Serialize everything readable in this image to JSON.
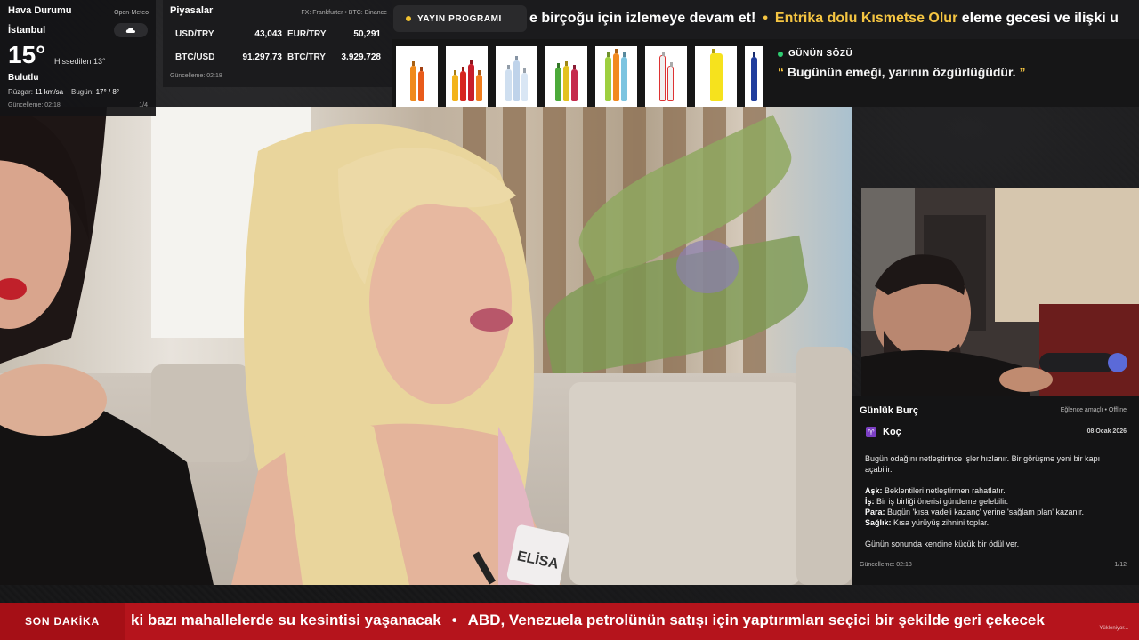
{
  "weather": {
    "title": "Hava Durumu",
    "source": "Open-Meteo",
    "city": "İstanbul",
    "temp": "15°",
    "feels_like": "Hissedilen 13°",
    "condition": "Bulutlu",
    "wind_label": "Rüzgar:",
    "wind_value": "11 km/sa",
    "today_label": "Bugün:",
    "today_value": "17° / 8°",
    "updated": "Güncelleme: 02:18",
    "page": "1/4",
    "icon": "cloud-icon"
  },
  "markets": {
    "title": "Piyasalar",
    "source": "FX: Frankfurter • BTC: Binance",
    "items": [
      {
        "label": "USD/TRY",
        "value": "43,043"
      },
      {
        "label": "EUR/TRY",
        "value": "50,291"
      },
      {
        "label": "BTC/USD",
        "value": "91.297,73"
      },
      {
        "label": "BTC/TRY",
        "value": "3.929.728"
      }
    ],
    "updated": "Güncelleme: 02:18"
  },
  "program": {
    "badge": "YAYIN PROGRAMI",
    "text_before": "e birçoğu için izlemeye devam et!",
    "separator": "•",
    "highlight": "Entrika dolu Kısmetse Olur",
    "text_after": "eleme gecesi ve ilişki u"
  },
  "quote": {
    "title": "GÜNÜN SÖZÜ",
    "open_mark": "“",
    "text": "Bugünün emeği, yarının özgürlüğüdür.",
    "close_mark": "”"
  },
  "horoscope": {
    "title": "Günlük Burç",
    "note": "Eğlence amaçlı • Offline",
    "sign_symbol": "♈",
    "sign": "Koç",
    "date": "08 Ocak 2026",
    "intro": "Bugün odağını netleştirince işler hızlanır. Bir görüşme yeni bir kapı açabilir.",
    "love_label": "Aşk:",
    "love": "Beklentileri netleştirmen rahatlatır.",
    "work_label": "İş:",
    "work": "Bir iş birliği önerisi gündeme gelebilir.",
    "money_label": "Para:",
    "money": "Bugün 'kısa vadeli kazanç' yerine 'sağlam plan' kazanır.",
    "health_label": "Sağlık:",
    "health": "Kısa yürüyüş zihnini toplar.",
    "closing": "Günün sonunda kendine küçük bir ödül ver.",
    "updated": "Güncelleme: 02:18",
    "page": "1/12"
  },
  "video": {
    "name_tag": "ELİSA"
  },
  "news": {
    "badge": "SON DAKİKA",
    "item1": "ki bazı mahallelerde su kesintisi yaşanacak",
    "separator": "•",
    "item2": "ABD, Venezuela petrolünün satışı için yaptırımları seçici bir şekilde geri çekecek",
    "status": "Yükleniyor..."
  },
  "colors": {
    "accent_yellow": "#f5c542",
    "news_red": "#b5141c",
    "quote_dot": "#2ecc71",
    "program_dot": "#f2c230"
  }
}
